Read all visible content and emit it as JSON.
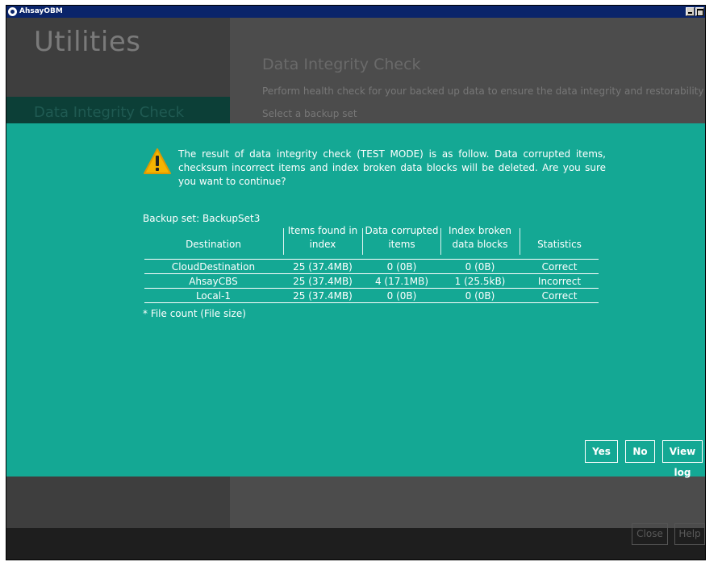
{
  "window": {
    "title": "AhsayOBM"
  },
  "left": {
    "title": "Utilities",
    "active_item": "Data Integrity Check"
  },
  "main": {
    "title": "Data Integrity Check",
    "description": "Perform health check for your backed up data to ensure the data integrity and restorability",
    "select_label": "Select a backup set"
  },
  "footer": {
    "close_label": "Close",
    "help_label": "Help"
  },
  "dialog": {
    "message": "The result of data integrity check (TEST MODE) is as follow. Data corrupted items, checksum incorrect items and index broken data blocks will be deleted. Are you sure you want to continue?",
    "backup_set": "Backup set: BackupSet3",
    "headers": [
      "Destination",
      "Items found in index",
      "Data corrupted items",
      "Index broken data blocks",
      "Statistics"
    ],
    "rows": [
      [
        "CloudDestination",
        "25 (37.4MB)",
        "0 (0B)",
        "0 (0B)",
        "Correct"
      ],
      [
        "AhsayCBS",
        "25 (37.4MB)",
        "4 (17.1MB)",
        "1 (25.5kB)",
        "Incorrect"
      ],
      [
        "Local-1",
        "25 (37.4MB)",
        "0 (0B)",
        "0 (0B)",
        "Correct"
      ]
    ],
    "note": "* File count (File size)",
    "yes_label": "Yes",
    "no_label": "No",
    "viewlog_label": "View log",
    "icon": "warning-icon",
    "accent_color": "#14a894"
  }
}
